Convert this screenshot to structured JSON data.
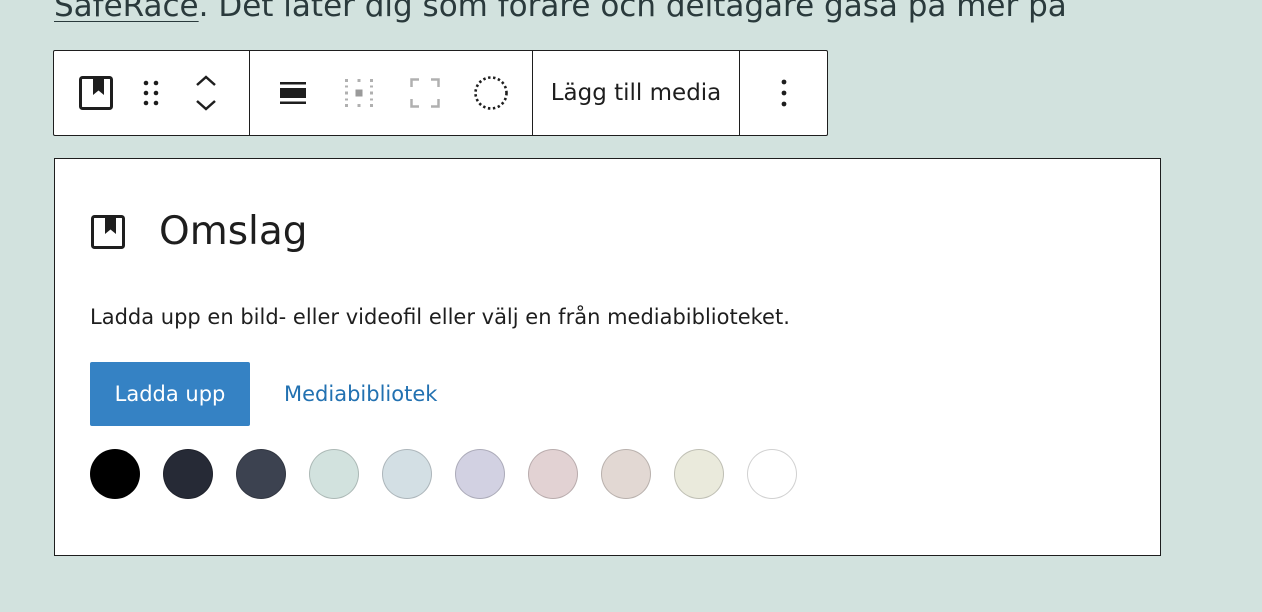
{
  "paragraph": {
    "link_text": "SafeRace",
    "rest_text": ". Det låter dig som förare och deltagare gasa på mer på"
  },
  "toolbar": {
    "block_type_icon": "cover-block-icon",
    "drag_icon": "drag-handle-icon",
    "move_up_icon": "chevron-up-icon",
    "move_down_icon": "chevron-down-icon",
    "align_icon": "align-wide-icon",
    "content_position_icon": "position-grid-icon",
    "full_height_icon": "full-height-icon",
    "duotone_icon": "dotted-circle-icon",
    "add_media_label": "Lägg till media",
    "options_icon": "more-vertical-icon"
  },
  "cover": {
    "title": "Omslag",
    "instructions": "Ladda upp en bild- eller videofil eller välj en från mediabiblioteket.",
    "upload_label": "Ladda upp",
    "library_label": "Mediabibliotek",
    "swatches": [
      "#000000",
      "#262a36",
      "#3c4250",
      "#d2e2de",
      "#d3dfe4",
      "#d2d1e2",
      "#e2d2d3",
      "#e2d8d3",
      "#eaeadc",
      "#ffffff"
    ]
  },
  "colors": {
    "page_bg": "#d2e2de",
    "primary_button": "#3582c4",
    "link": "#2271b1"
  }
}
